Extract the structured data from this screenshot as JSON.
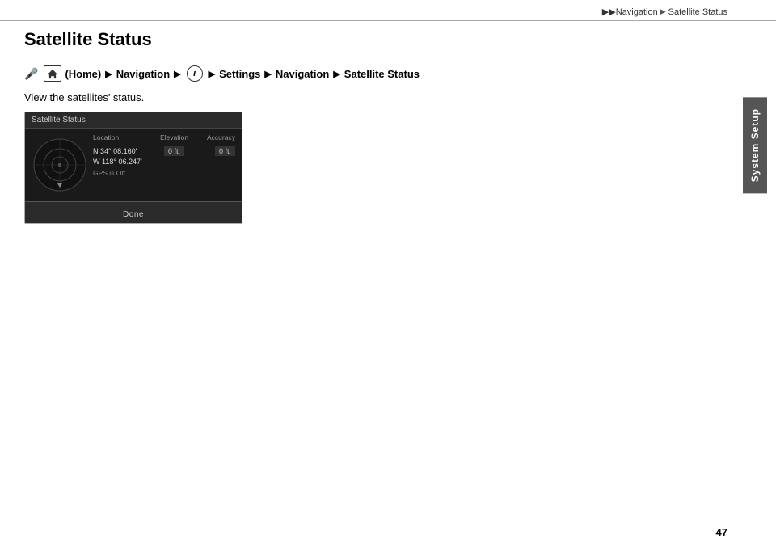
{
  "topbar": {
    "breadcrumb": [
      {
        "label": "▶▶",
        "type": "arrows"
      },
      {
        "label": "Navigation",
        "type": "text"
      },
      {
        "label": "▶",
        "type": "arrow"
      },
      {
        "label": "Satellite Status",
        "type": "text"
      }
    ]
  },
  "page": {
    "title": "Satellite Status",
    "description": "View the satellites' status."
  },
  "breadcrumb": {
    "mic_symbol": "🎤",
    "home_label": "HOME",
    "home_paren": "(Home)",
    "arrow": "▶",
    "navigation": "Navigation",
    "info_label": "i",
    "settings": "Settings",
    "nav2": "Navigation",
    "satellite_status": "Satellite Status"
  },
  "screen": {
    "title": "Satellite Status",
    "data": {
      "col_location": "Location",
      "col_elevation": "Elevation",
      "col_accuracy": "Accuracy",
      "lat": "N 34° 08.160'",
      "lon": "W 118° 06.247'",
      "gps_off": "GPS is Off",
      "elevation_val": "0 ft.",
      "accuracy_val": "0 ft."
    },
    "done_button": "Done"
  },
  "sidebar": {
    "label": "System Setup"
  },
  "page_number": "47"
}
